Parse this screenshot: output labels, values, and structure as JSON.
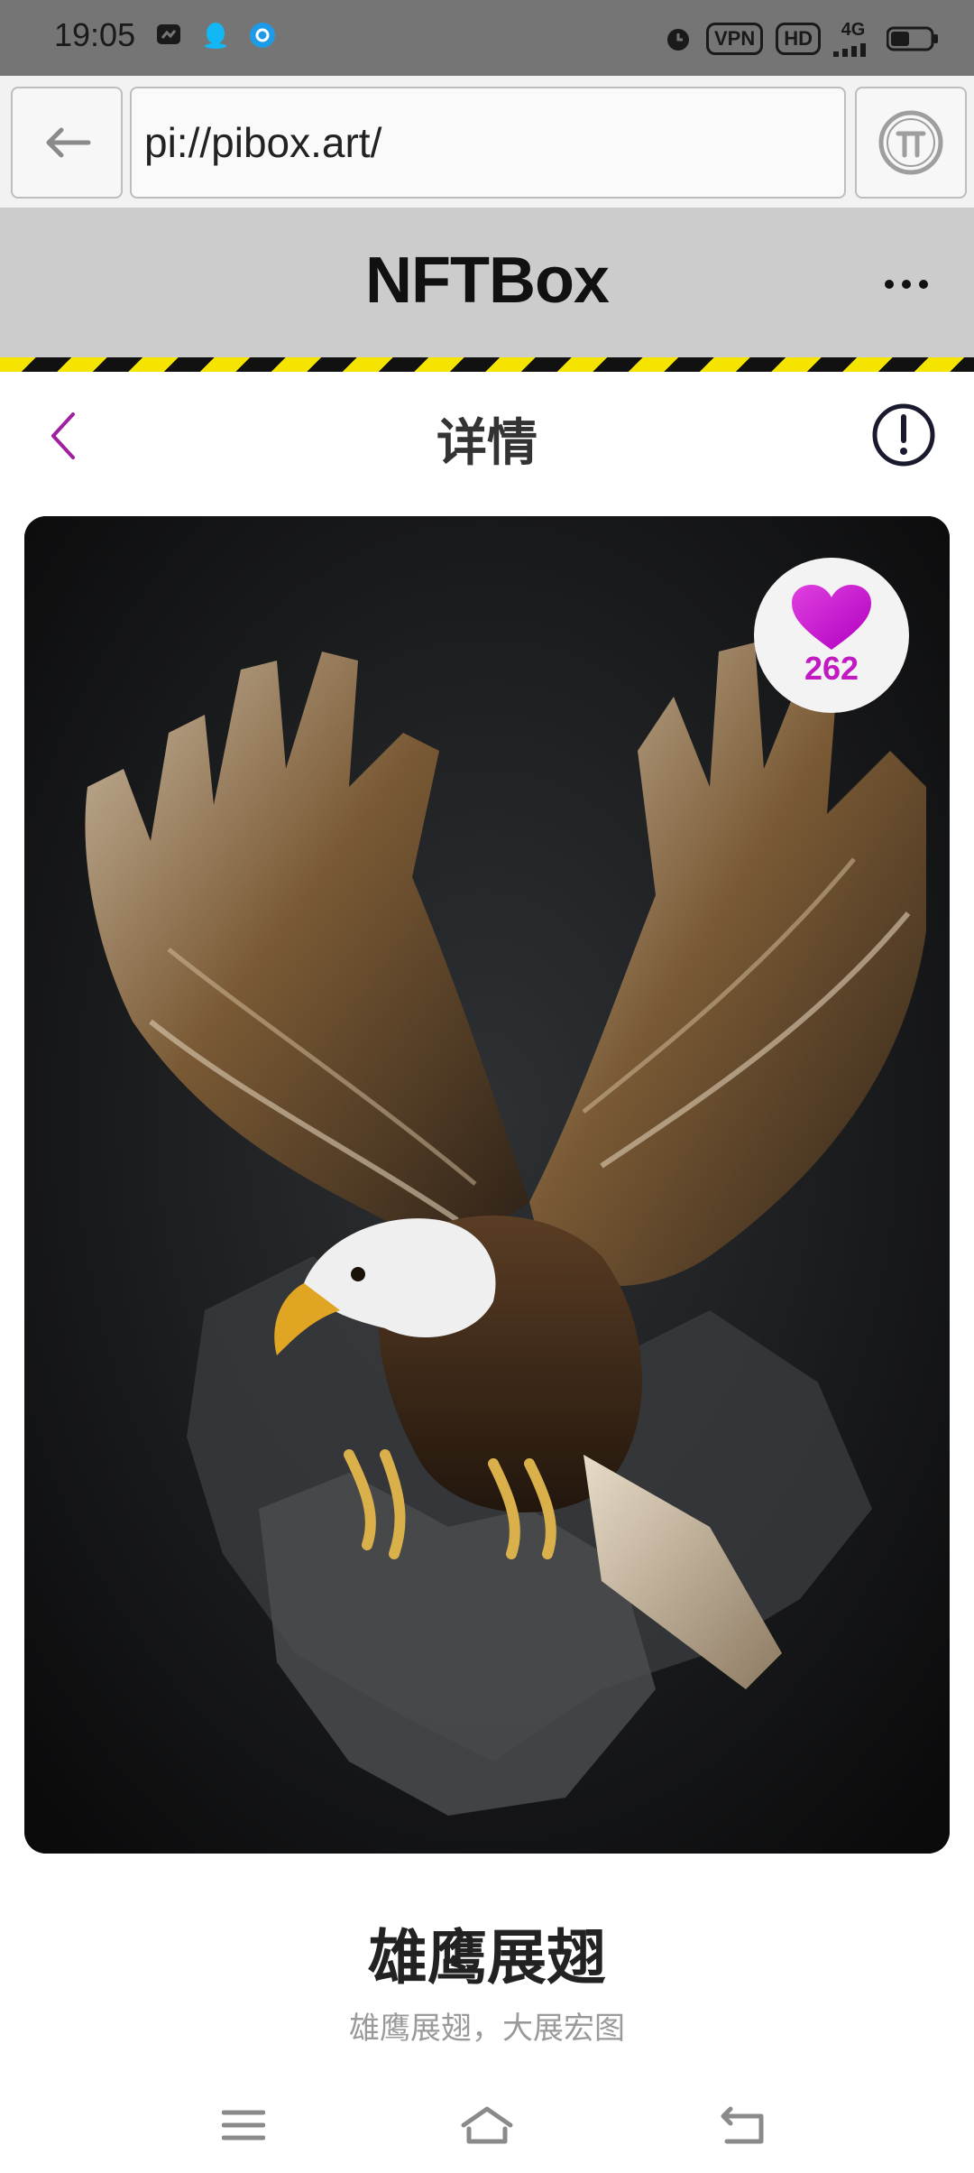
{
  "status_bar": {
    "time": "19:05",
    "left_icons": [
      "message-icon",
      "qq-icon",
      "browser-icon"
    ],
    "vpn_label": "VPN",
    "hd_label": "HD",
    "network_label": "4G",
    "right_icons": [
      "alarm-icon",
      "signal-icon",
      "battery-icon"
    ]
  },
  "browser": {
    "url": "pi://pibox.art/",
    "back_icon": "arrow-left-icon",
    "pi_icon": "pi-logo-icon"
  },
  "app_bar": {
    "title": "NFTBox",
    "more_icon": "more-dots-icon"
  },
  "detail_header": {
    "title": "详情",
    "back_icon": "chevron-left-icon",
    "info_icon": "info-circle-icon"
  },
  "nft": {
    "likes": "262",
    "title": "雄鹰展翅",
    "description": "雄鹰展翅，大展宏图"
  },
  "colors": {
    "accent_purple": "#a020a0",
    "like_pink": "#c21ac2",
    "hazard_yellow": "#f4e400"
  },
  "system_nav": {
    "icons": [
      "menu-icon",
      "home-icon",
      "back-icon"
    ]
  }
}
